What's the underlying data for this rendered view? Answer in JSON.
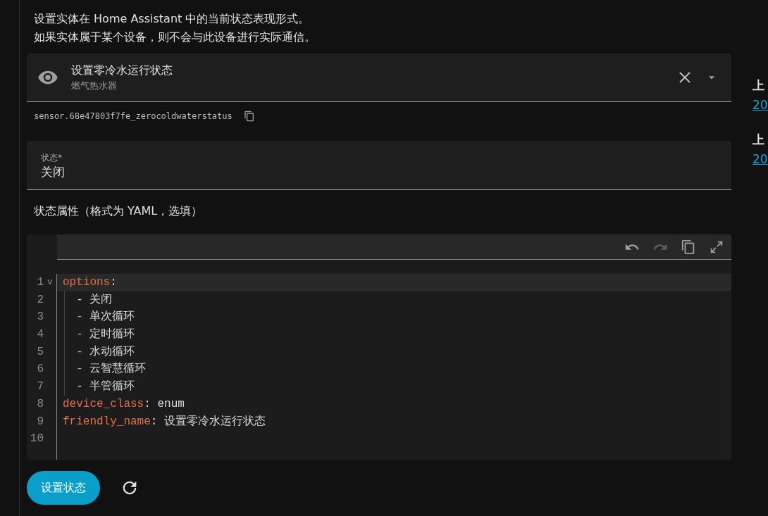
{
  "description": [
    "设置实体在 Home Assistant 中的当前状态表现形式。",
    "如果实体属于某个设备，则不会与此设备进行实际通信。"
  ],
  "entity_picker": {
    "name": "设置零冷水运行状态",
    "device": "燃气热水器"
  },
  "entity_id": "sensor.68e47803f7fe_zerocoldwaterstatus",
  "state_field": {
    "label": "状态*",
    "value": "关闭"
  },
  "attributes_label": "状态属性（格式为 YAML，选填）",
  "editor": {
    "lines": [
      {
        "number": "1",
        "fold_marker": "v",
        "active": true,
        "tokens": [
          {
            "kind": "key",
            "text": "options"
          },
          {
            "kind": "plain",
            "text": ":"
          }
        ]
      },
      {
        "number": "2",
        "active": false,
        "guide": true,
        "tokens": [
          {
            "kind": "plain",
            "text": "  - 关闭"
          }
        ]
      },
      {
        "number": "3",
        "active": false,
        "guide": true,
        "tokens": [
          {
            "kind": "dash",
            "text": "  -"
          },
          {
            "kind": "plain",
            "text": " 单次循环"
          }
        ]
      },
      {
        "number": "4",
        "active": false,
        "guide": true,
        "tokens": [
          {
            "kind": "dash",
            "text": "  -"
          },
          {
            "kind": "plain",
            "text": " 定时循环"
          }
        ]
      },
      {
        "number": "5",
        "active": false,
        "guide": true,
        "tokens": [
          {
            "kind": "dash",
            "text": "  -"
          },
          {
            "kind": "plain",
            "text": " 水动循环"
          }
        ]
      },
      {
        "number": "6",
        "active": false,
        "guide": true,
        "tokens": [
          {
            "kind": "dash",
            "text": "  -"
          },
          {
            "kind": "plain",
            "text": " 云智慧循环"
          }
        ]
      },
      {
        "number": "7",
        "active": false,
        "guide": true,
        "tokens": [
          {
            "kind": "plain",
            "text": "  - 半管循环"
          }
        ]
      },
      {
        "number": "8",
        "active": false,
        "tokens": [
          {
            "kind": "key",
            "text": "device_class"
          },
          {
            "kind": "plain",
            "text": ": enum"
          }
        ]
      },
      {
        "number": "9",
        "active": false,
        "tokens": [
          {
            "kind": "key",
            "text": "friendly_name"
          },
          {
            "kind": "plain",
            "text": ": 设置零冷水运行状态"
          }
        ]
      },
      {
        "number": "10",
        "active": false
      }
    ]
  },
  "set_state_button": "设置状态",
  "side_info": [
    {
      "label": "上",
      "link": "20"
    },
    {
      "label": "上",
      "link": "20"
    }
  ]
}
